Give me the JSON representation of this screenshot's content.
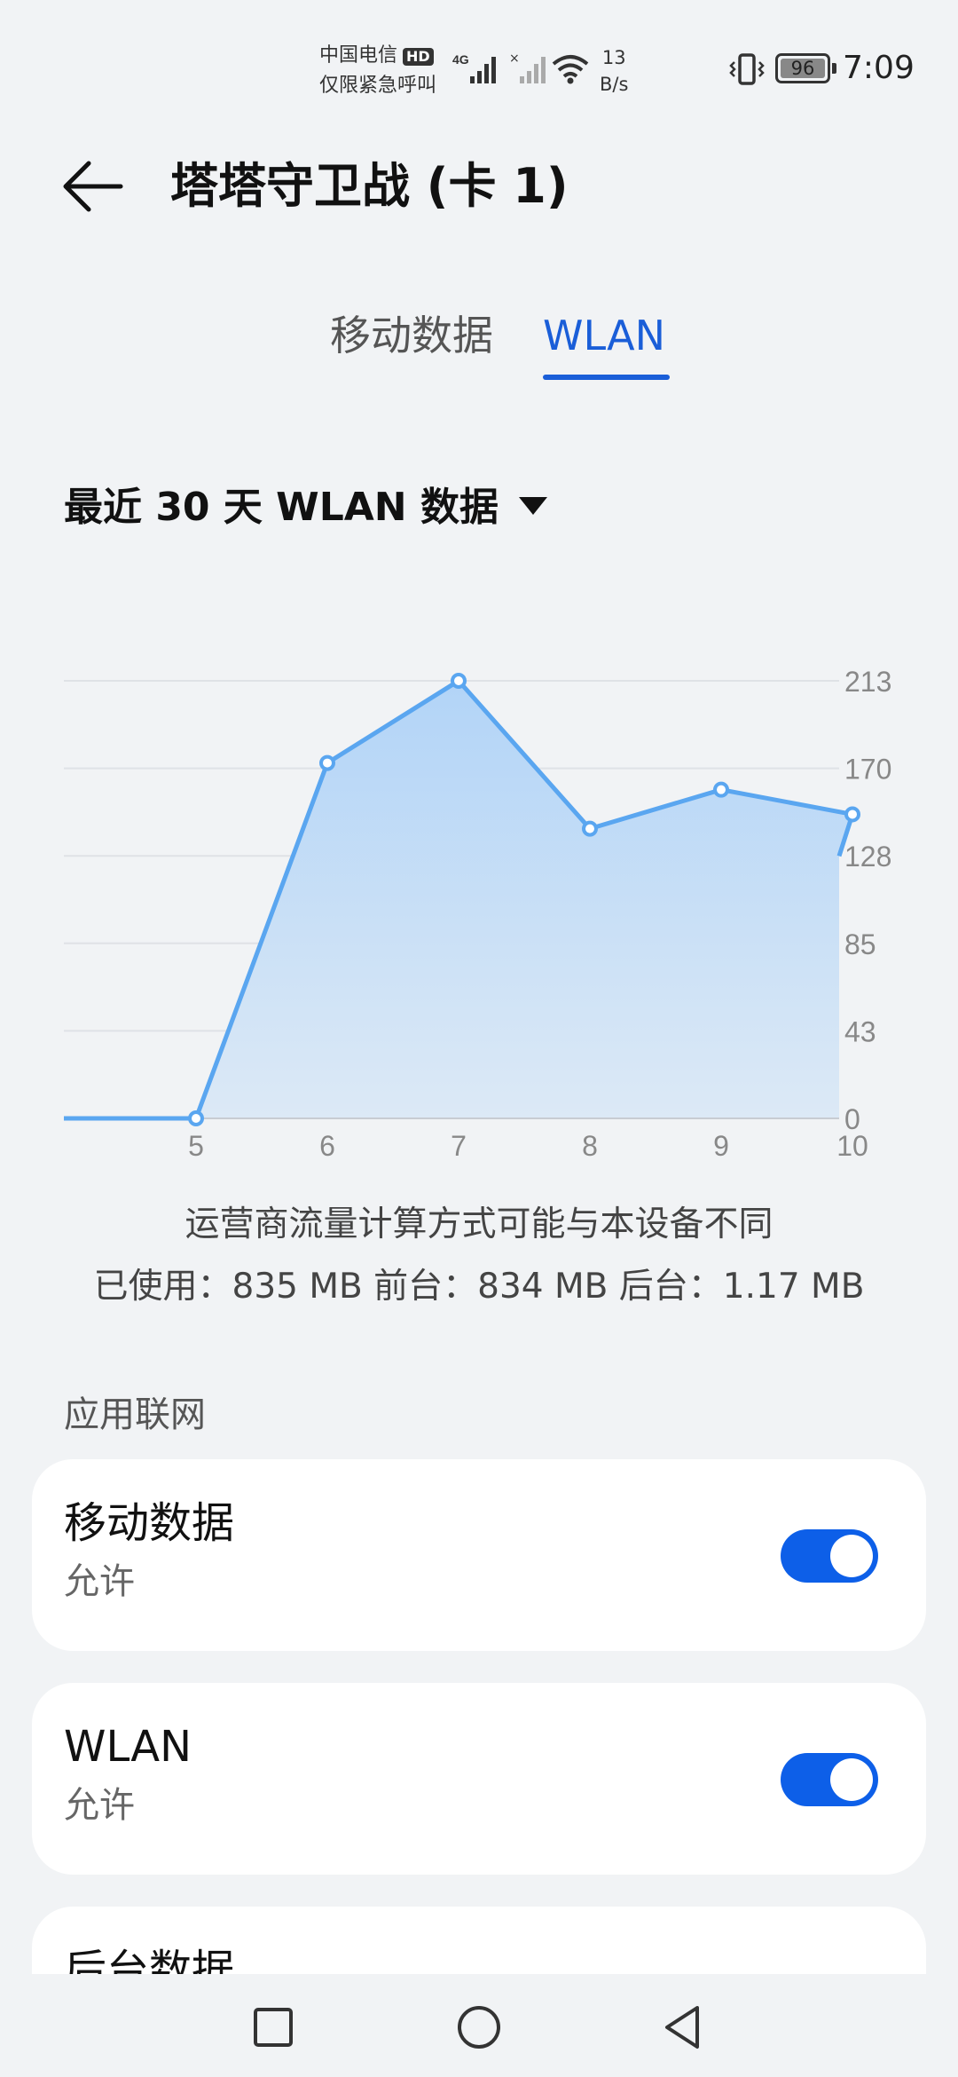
{
  "status_bar": {
    "carrier_line1": "中国电信",
    "hd_badge": "HD",
    "carrier_line2": "仅限紧急呼叫",
    "network_type": "4G",
    "net_speed_value": "13",
    "net_speed_unit": "B/s",
    "battery_level": "96",
    "time": "7:09"
  },
  "header": {
    "back_icon": "arrow-left-icon",
    "title": "塔塔守卫战 (卡 1)"
  },
  "tabs": [
    {
      "label": "移动数据",
      "active": false
    },
    {
      "label": "WLAN",
      "active": true
    }
  ],
  "period_selector": {
    "label": "最近 30 天 WLAN 数据",
    "icon": "caret-down-icon"
  },
  "chart_data": {
    "type": "area",
    "categories": [
      "",
      "5",
      "6",
      "7",
      "8",
      "9",
      "10"
    ],
    "values": [
      0,
      0,
      173,
      213,
      141,
      160,
      148
    ],
    "ytick_labels": [
      "213",
      "170",
      "128",
      "85",
      "43",
      "0"
    ],
    "ylim": [
      0,
      213
    ],
    "grid": true,
    "color": "#5aa6f0"
  },
  "notes": {
    "line1": "运营商流量计算方式可能与本设备不同",
    "line2": "已使用：835 MB 前台：834 MB 后台：1.17 MB"
  },
  "section": {
    "label": "应用联网"
  },
  "settings": [
    {
      "title": "移动数据",
      "status": "允许",
      "enabled": true
    },
    {
      "title": "WLAN",
      "status": "允许",
      "enabled": true
    },
    {
      "title": "后台数据"
    }
  ],
  "accent_color": "#0d5fe8",
  "nav_bar": {
    "recent_icon": "square-icon",
    "home_icon": "circle-icon",
    "back_icon": "triangle-back-icon"
  }
}
